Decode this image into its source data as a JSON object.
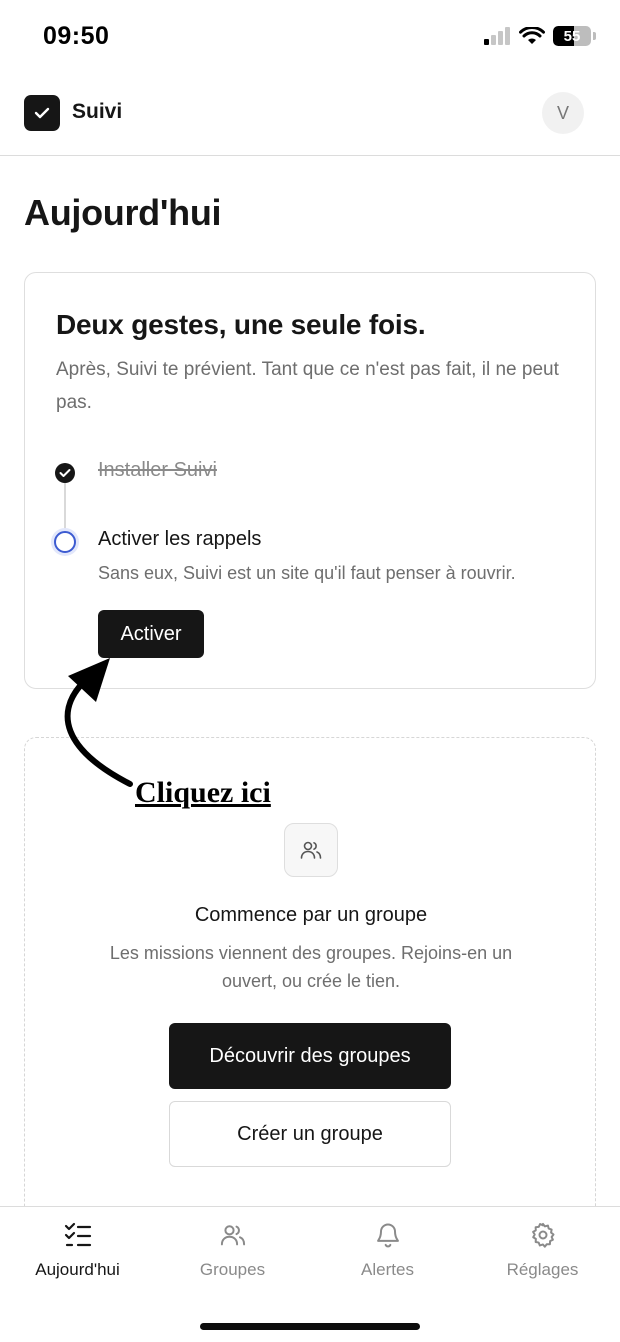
{
  "status": {
    "time": "09:50",
    "battery": "55",
    "battery_level_percent": 55,
    "icons": [
      "signal-icon",
      "wifi-icon",
      "battery-icon"
    ]
  },
  "header": {
    "app_name": "Suivi",
    "avatar_initial": "V"
  },
  "page_title": "Aujourd'hui",
  "onboarding": {
    "title": "Deux gestes, une seule fois.",
    "subtitle": "Après, Suivi te prévient. Tant que ce n'est pas fait, il ne peut pas.",
    "steps": [
      {
        "label": "Installer Suivi",
        "done": true
      },
      {
        "label": "Activer les rappels",
        "description": "Sans eux, Suivi est un site qu'il faut penser à rouvrir.",
        "done": false
      }
    ],
    "button_label": "Activer"
  },
  "annotation": {
    "text": "Cliquez ici"
  },
  "groups": {
    "title": "Commence par un groupe",
    "description": "Les missions viennent des groupes. Rejoins-en un ouvert, ou crée le tien.",
    "discover_label": "Découvrir des groupes",
    "create_label": "Créer un groupe"
  },
  "nav": {
    "items": [
      {
        "label": "Aujourd'hui",
        "icon": "checklist-icon",
        "active": true
      },
      {
        "label": "Groupes",
        "icon": "users-icon",
        "active": false
      },
      {
        "label": "Alertes",
        "icon": "bell-icon",
        "active": false
      },
      {
        "label": "Réglages",
        "icon": "gear-icon",
        "active": false
      }
    ]
  },
  "colors": {
    "primary": "#161616",
    "muted_text": "#6e6e6e",
    "pending_step_accent": "#3c5bd1",
    "border": "#dedede"
  }
}
